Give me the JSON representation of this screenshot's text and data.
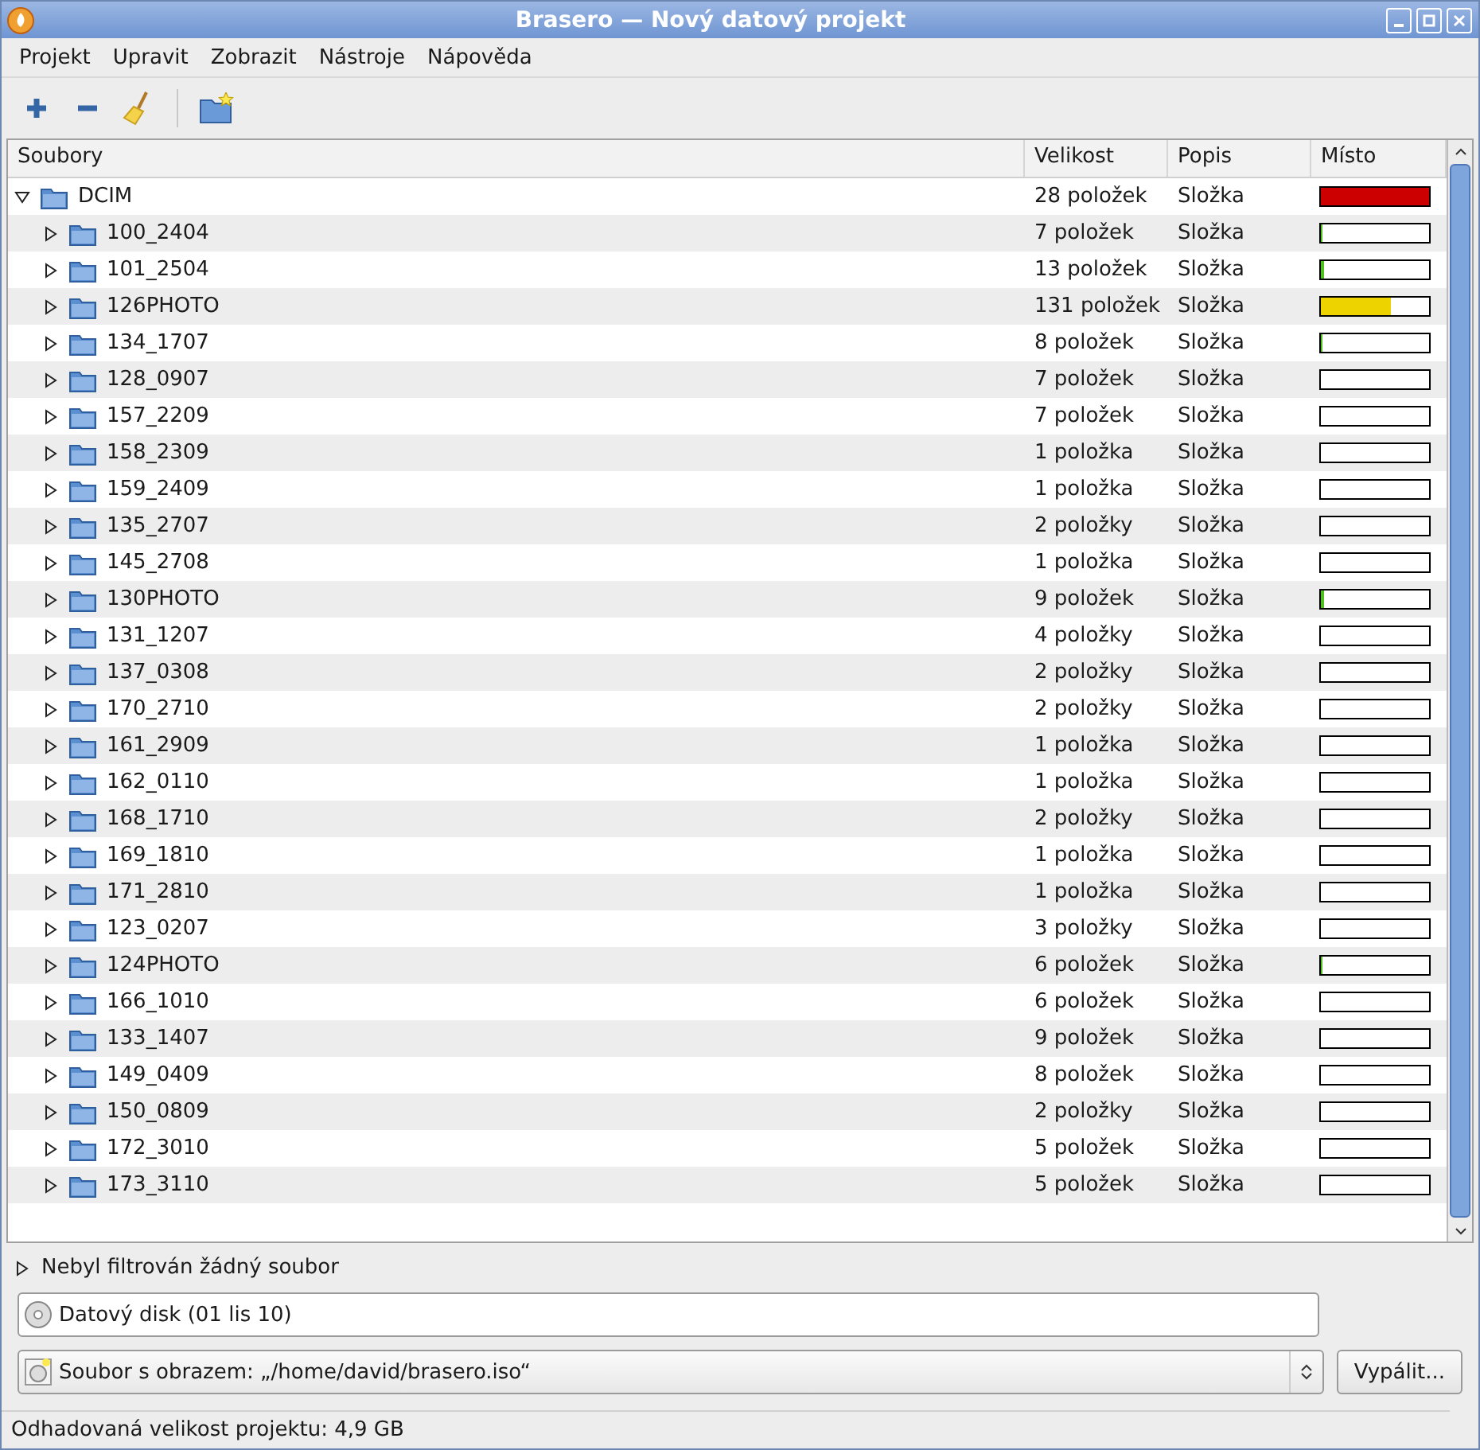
{
  "window": {
    "title": "Brasero — Nový datový projekt"
  },
  "menu": [
    "Projekt",
    "Upravit",
    "Zobrazit",
    "Nástroje",
    "Nápověda"
  ],
  "table": {
    "columns": [
      "Soubory",
      "Velikost",
      "Popis",
      "Místo"
    ],
    "rows": [
      {
        "name": "DCIM",
        "size": "28 položek",
        "type": "Složka",
        "level": 1,
        "expanded": true,
        "children": [
          {
            "name": "100_2404",
            "size": "7 položek",
            "type": "Složka",
            "level": 0.02,
            "expanded": false
          },
          {
            "name": "101_2504",
            "size": "13 položek",
            "type": "Složka",
            "level": 0.03,
            "expanded": false
          },
          {
            "name": "126PHOTO",
            "size": "131 položek",
            "type": "Složka",
            "level": 0.65,
            "expanded": false
          },
          {
            "name": "134_1707",
            "size": "8 položek",
            "type": "Složka",
            "level": 0.02,
            "expanded": false
          },
          {
            "name": "128_0907",
            "size": "7 položek",
            "type": "Složka",
            "level": 0,
            "expanded": false
          },
          {
            "name": "157_2209",
            "size": "7 položek",
            "type": "Složka",
            "level": 0,
            "expanded": false
          },
          {
            "name": "158_2309",
            "size": "1 položka",
            "type": "Složka",
            "level": 0,
            "expanded": false
          },
          {
            "name": "159_2409",
            "size": "1 položka",
            "type": "Složka",
            "level": 0,
            "expanded": false
          },
          {
            "name": "135_2707",
            "size": "2 položky",
            "type": "Složka",
            "level": 0,
            "expanded": false
          },
          {
            "name": "145_2708",
            "size": "1 položka",
            "type": "Složka",
            "level": 0,
            "expanded": false
          },
          {
            "name": "130PHOTO",
            "size": "9 položek",
            "type": "Složka",
            "level": 0.03,
            "expanded": false
          },
          {
            "name": "131_1207",
            "size": "4 položky",
            "type": "Složka",
            "level": 0,
            "expanded": false
          },
          {
            "name": "137_0308",
            "size": "2 položky",
            "type": "Složka",
            "level": 0,
            "expanded": false
          },
          {
            "name": "170_2710",
            "size": "2 položky",
            "type": "Složka",
            "level": 0,
            "expanded": false
          },
          {
            "name": "161_2909",
            "size": "1 položka",
            "type": "Složka",
            "level": 0,
            "expanded": false
          },
          {
            "name": "162_0110",
            "size": "1 položka",
            "type": "Složka",
            "level": 0,
            "expanded": false
          },
          {
            "name": "168_1710",
            "size": "2 položky",
            "type": "Složka",
            "level": 0,
            "expanded": false
          },
          {
            "name": "169_1810",
            "size": "1 položka",
            "type": "Složka",
            "level": 0,
            "expanded": false
          },
          {
            "name": "171_2810",
            "size": "1 položka",
            "type": "Složka",
            "level": 0,
            "expanded": false
          },
          {
            "name": "123_0207",
            "size": "3 položky",
            "type": "Složka",
            "level": 0,
            "expanded": false
          },
          {
            "name": "124PHOTO",
            "size": "6 položek",
            "type": "Složka",
            "level": 0.02,
            "expanded": false
          },
          {
            "name": "166_1010",
            "size": "6 položek",
            "type": "Složka",
            "level": 0,
            "expanded": false
          },
          {
            "name": "133_1407",
            "size": "9 položek",
            "type": "Složka",
            "level": 0,
            "expanded": false
          },
          {
            "name": "149_0409",
            "size": "8 položek",
            "type": "Složka",
            "level": 0,
            "expanded": false
          },
          {
            "name": "150_0809",
            "size": "2 položky",
            "type": "Složka",
            "level": 0,
            "expanded": false
          },
          {
            "name": "172_3010",
            "size": "5 položek",
            "type": "Složka",
            "level": 0,
            "expanded": false
          },
          {
            "name": "173_3110",
            "size": "5 položek",
            "type": "Složka",
            "level": 0,
            "expanded": false
          }
        ]
      }
    ]
  },
  "filter": {
    "label": "Nebyl filtrován žádný soubor",
    "expanded": false
  },
  "disc_name": {
    "value": "Datový disk (01 lis 10)"
  },
  "destination": {
    "value": "Soubor s obrazem: „/home/david/brasero.iso“"
  },
  "burn_button": "Vypálit...",
  "status_bar": "Odhadovaná velikost projektu: 4,9 GB"
}
